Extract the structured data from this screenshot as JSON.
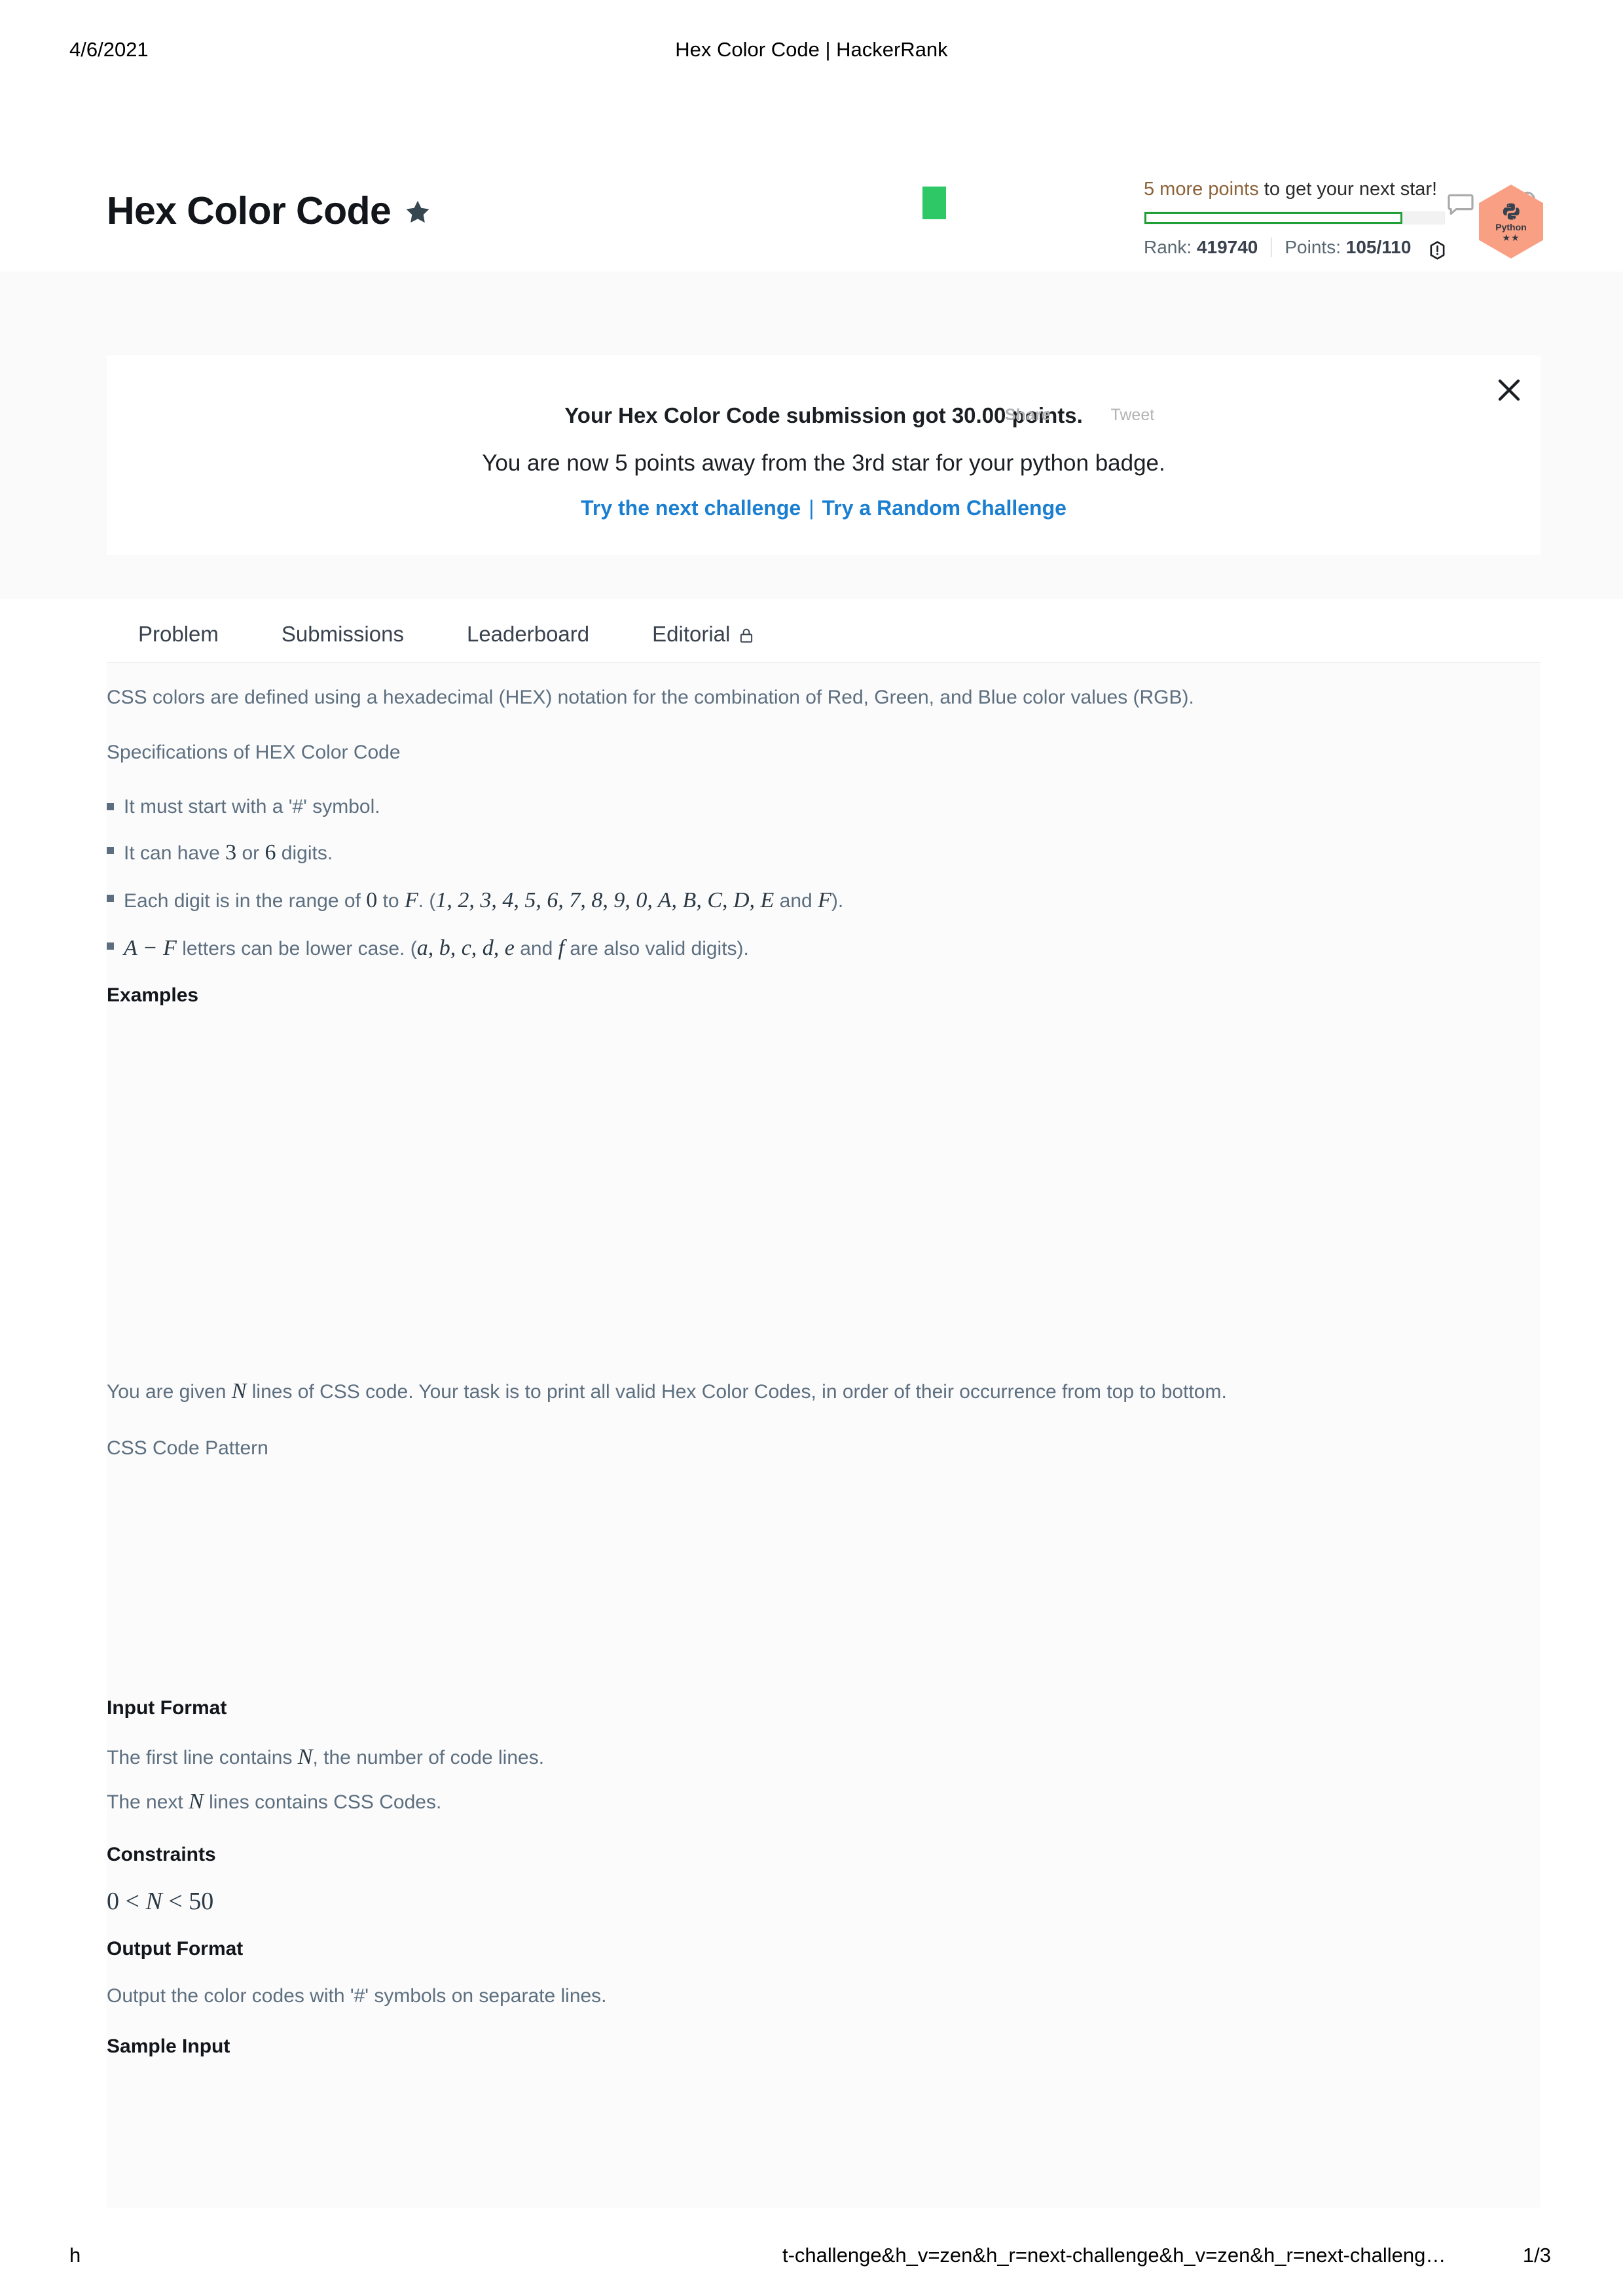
{
  "print": {
    "date": "4/6/2021",
    "doc_title": "Hex Color Code | HackerRank",
    "footer_left": "h",
    "footer_url": "t-challenge&h_v=zen&h_r=next-challenge&h_v=zen&h_r=next-challeng…",
    "footer_page": "1/3"
  },
  "topnav": {
    "logo": "hackerrank-logo",
    "icons": [
      "chat-icon",
      "notification-bell-icon"
    ]
  },
  "challenge_header": {
    "title": "Hex Color Code",
    "star_icon": "star-icon",
    "next_star_points": "5 more points",
    "next_star_rest": " to get your next star!",
    "progress_percent": 86,
    "rank_label": "Rank:",
    "rank_value": "419740",
    "points_label": "Points:",
    "points_value": "105/110",
    "info_icon": "info-icon",
    "badge": {
      "label": "Python",
      "stars": "★★",
      "color": "#f9a084"
    }
  },
  "banner": {
    "headline": "Your Hex Color Code submission got 30.00 points.",
    "share_label": "Share",
    "tweet_label": "Tweet",
    "subline": "You are now 5 points away from the 3rd star for your python badge.",
    "link_next": "Try the next challenge",
    "link_sep": "|",
    "link_random": "Try a Random Challenge",
    "close_icon": "close-icon",
    "link_color": "#1b7fd1"
  },
  "tabs": [
    {
      "label": "Problem",
      "icon": null
    },
    {
      "label": "Submissions",
      "icon": null
    },
    {
      "label": "Leaderboard",
      "icon": null
    },
    {
      "label": "Editorial",
      "icon": "lock-icon"
    }
  ],
  "problem": {
    "intro": "CSS colors are defined using a hexadecimal (HEX) notation for the combination of Red, Green, and Blue color values (RGB).",
    "spec_heading": "Specifications of HEX Color Code",
    "specs": [
      {
        "pre": "It must start with a '#' symbol.",
        "math": null,
        "post": ""
      },
      {
        "pre": "It can have ",
        "math": "3",
        "mid": " or ",
        "math2": "6",
        "post": " digits."
      },
      {
        "pre": "Each digit is in the range of ",
        "math": "0",
        "mid": " to ",
        "math2": "F",
        "mid2": ". (",
        "math3": "1, 2, 3, 4, 5, 6, 7, 8, 9, 0, A, B, C, D, E",
        "mid3": " and ",
        "math4": "F",
        "post": ")."
      },
      {
        "math": "A − F",
        "mid": " letters can be lower case. (",
        "math2": "a, b, c, d, e",
        "mid2": " and ",
        "math3": "f",
        "post": " are also valid digits)."
      }
    ],
    "examples_heading": "Examples",
    "task_pre": "You are given ",
    "task_math": "N",
    "task_post": " lines of CSS code. Your task is to print all valid Hex Color Codes, in order of their occurrence from top to bottom.",
    "css_pattern_heading": "CSS Code Pattern",
    "input_format_heading": "Input Format",
    "input_line1_pre": "The first line contains ",
    "input_line1_math": "N",
    "input_line1_post": ", the number of code lines.",
    "input_line2_pre": "The next ",
    "input_line2_math": "N",
    "input_line2_post": " lines contains CSS Codes.",
    "constraints_heading": "Constraints",
    "constraints_expr_a": "0 < ",
    "constraints_expr_var": "N",
    "constraints_expr_b": " < 50",
    "output_format_heading": "Output Format",
    "output_format_text": "Output the color codes with '#' symbols on separate lines.",
    "sample_input_heading": "Sample Input"
  }
}
